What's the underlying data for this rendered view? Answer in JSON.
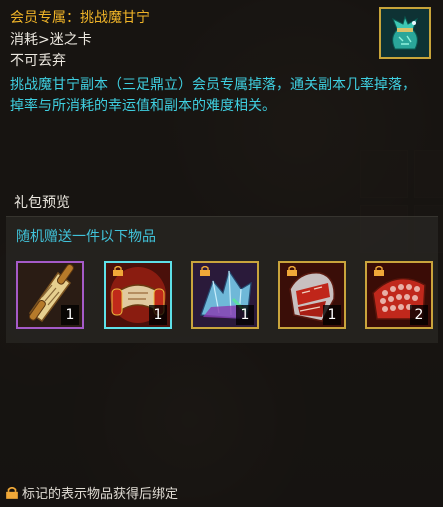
{
  "item": {
    "title": "会员专属：挑战魔甘宁",
    "consume": "消耗>迷之卡",
    "bind_status": "不可丢弃",
    "description": "挑战魔甘宁副本（三足鼎立）会员专属掉落，通关副本几率掉落，掉率与所消耗的幸运值和副本的难度相关。",
    "icon": "green-gift-bag-icon"
  },
  "gift_preview": {
    "section_title": "礼包预览",
    "subtitle": "随机赠送一件以下物品",
    "items": [
      {
        "icon": "golden-scroll-icon",
        "quantity": "1",
        "bound": false,
        "border": "#a55ac8"
      },
      {
        "icon": "red-scroll-icon",
        "quantity": "1",
        "bound": true,
        "border": "#5ee0e8"
      },
      {
        "icon": "crystal-cluster-icon",
        "quantity": "1",
        "bound": true,
        "border": "#c9a43c"
      },
      {
        "icon": "red-armor-icon",
        "quantity": "1",
        "bound": true,
        "border": "#c9a43c"
      },
      {
        "icon": "red-scale-armor-icon",
        "quantity": "2",
        "bound": true,
        "border": "#c9a43c"
      }
    ]
  },
  "footer": {
    "note": "标记的表示物品获得后绑定"
  },
  "colors": {
    "title": "#f0b428",
    "description": "#3fcfe0",
    "text": "#ece8e0"
  }
}
